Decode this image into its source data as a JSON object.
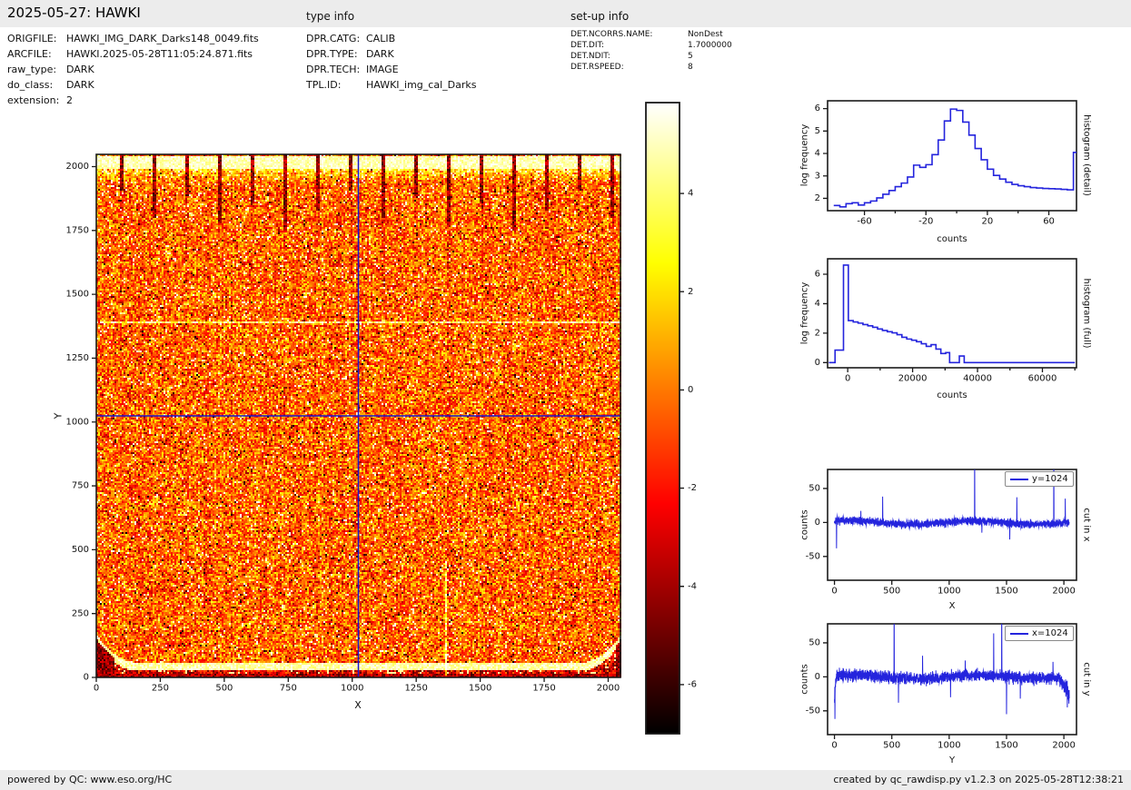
{
  "header": {
    "title": "2025-05-27: HAWKI",
    "type_info_heading": "type info",
    "setup_info_heading": "set-up info"
  },
  "file_info": {
    "rows": [
      {
        "label": "ORIGFILE:",
        "value": "HAWKI_IMG_DARK_Darks148_0049.fits"
      },
      {
        "label": "ARCFILE:",
        "value": "HAWKI.2025-05-28T11:05:24.871.fits"
      },
      {
        "label": "raw_type:",
        "value": "DARK"
      },
      {
        "label": "do_class:",
        "value": "DARK"
      },
      {
        "label": "extension:",
        "value": "2"
      }
    ]
  },
  "type_info": {
    "rows": [
      {
        "label": "DPR.CATG:",
        "value": "CALIB"
      },
      {
        "label": "DPR.TYPE:",
        "value": "DARK"
      },
      {
        "label": "DPR.TECH:",
        "value": "IMAGE"
      },
      {
        "label": "TPL.ID:",
        "value": "HAWKI_img_cal_Darks"
      }
    ]
  },
  "setup_info": {
    "rows": [
      {
        "label": "DET.NCORRS.NAME:",
        "value": "NonDest"
      },
      {
        "label": "DET.DIT:",
        "value": "1.7000000"
      },
      {
        "label": "DET.NDIT:",
        "value": "5"
      },
      {
        "label": "DET.RSPEED:",
        "value": "8"
      }
    ]
  },
  "footer": {
    "left": "powered by QC: www.eso.org/HC",
    "right": "created by qc_rawdisp.py v1.2.3 on 2025-05-28T12:38:21"
  },
  "colors": {
    "line_blue": "#2424dd",
    "crosshair_blue": "#1818cc",
    "frame": "#1a1a1a",
    "bar_bg": "#ececec",
    "text": "#111111"
  },
  "chart_data": [
    {
      "id": "main-image",
      "type": "heatmap",
      "xlabel": "X",
      "ylabel": "Y",
      "xlim": [
        0,
        2048
      ],
      "ylim": [
        0,
        2048
      ],
      "xticks": [
        0,
        250,
        500,
        750,
        1000,
        1250,
        1500,
        1750,
        2000
      ],
      "yticks": [
        0,
        250,
        500,
        750,
        1000,
        1250,
        1500,
        1750,
        2000
      ],
      "colormap": "hot",
      "noise": {
        "mean": 0.52,
        "spread": 0.17,
        "dark_fraction": 0.1,
        "bright_fraction": 0.07,
        "seed": 42
      },
      "features": {
        "top_band": {
          "y_from": 1992,
          "y_to": 2038
        },
        "top_streaks": {
          "start_x": 96,
          "spacing": 128,
          "count": 16,
          "min_len": 140,
          "max_len": 300
        },
        "bottom_band": {
          "center_y": 42,
          "half_width": 16,
          "edge_rise": 110,
          "left_edge_x": 160,
          "right_edge_x": 1890
        },
        "white_hline_y": 1388,
        "white_vline": {
          "x": 1363,
          "y_max": 450
        },
        "crosshair": {
          "x": 1024,
          "y": 1024
        }
      }
    },
    {
      "id": "colorbar",
      "type": "colorbar",
      "colormap": "hot",
      "vmax": 5.85,
      "vmin": -7.0,
      "ticks": [
        4,
        2,
        0,
        -2,
        -4,
        -6
      ]
    },
    {
      "id": "hist-detail",
      "type": "step-histogram",
      "xlabel": "counts",
      "ylabel": "log frequency",
      "right_label": "histogram (detail)",
      "xlim": [
        -84,
        78
      ],
      "ylim": [
        1.45,
        6.35
      ],
      "xticks": [
        -60,
        -20,
        20,
        60
      ],
      "xticks_minor": [
        -40,
        0,
        40
      ],
      "yticks": [
        2,
        3,
        4,
        5,
        6
      ],
      "bin_edges": [
        -80,
        -76,
        -72,
        -68,
        -64,
        -60,
        -56,
        -52,
        -48,
        -44,
        -40,
        -36,
        -32,
        -28,
        -24,
        -20,
        -16,
        -12,
        -8,
        -4,
        0,
        4,
        8,
        12,
        16,
        20,
        24,
        28,
        32,
        36,
        40,
        44,
        48,
        52,
        56,
        60,
        64,
        68,
        72,
        76,
        78
      ],
      "values": [
        1.68,
        1.62,
        1.76,
        1.8,
        1.7,
        1.8,
        1.88,
        2.02,
        2.18,
        2.35,
        2.52,
        2.68,
        2.95,
        3.48,
        3.38,
        3.5,
        3.95,
        4.6,
        5.45,
        5.98,
        5.92,
        5.4,
        4.82,
        4.22,
        3.72,
        3.3,
        3.02,
        2.86,
        2.72,
        2.62,
        2.56,
        2.52,
        2.48,
        2.46,
        2.44,
        2.43,
        2.42,
        2.4,
        2.38,
        4.05
      ]
    },
    {
      "id": "hist-full",
      "type": "step-histogram",
      "xlabel": "counts",
      "ylabel": "log frequency",
      "right_label": "histogram (full)",
      "xlim": [
        -6200,
        70500
      ],
      "ylim": [
        -0.35,
        7.05
      ],
      "xticks": [
        0,
        20000,
        40000,
        60000
      ],
      "xticks_minor": [
        10000,
        30000,
        50000,
        70000
      ],
      "yticks": [
        0,
        2,
        4,
        6
      ],
      "bin_edges": [
        -5800,
        -3900,
        -1300,
        200,
        1700,
        3200,
        4700,
        6200,
        7700,
        9200,
        10700,
        12200,
        13700,
        15200,
        16700,
        18200,
        19700,
        21200,
        22700,
        24200,
        25700,
        27200,
        28700,
        30200,
        31400,
        34400,
        35900,
        70000
      ],
      "values": [
        0,
        0.85,
        6.62,
        2.85,
        2.76,
        2.68,
        2.58,
        2.5,
        2.4,
        2.28,
        2.18,
        2.1,
        2.02,
        1.9,
        1.72,
        1.6,
        1.52,
        1.42,
        1.28,
        1.1,
        1.22,
        0.92,
        0.62,
        0.68,
        0.0,
        0.45,
        0.0
      ]
    },
    {
      "id": "cut-x",
      "type": "line-noise",
      "xlabel": "X",
      "ylabel": "counts",
      "right_label": "cut in x",
      "legend": "y=1024",
      "xlim": [
        -60,
        2110
      ],
      "ylim": [
        -85,
        78
      ],
      "xticks": [
        0,
        500,
        1000,
        1500,
        2000
      ],
      "yticks": [
        -50,
        0,
        50
      ],
      "n": 2048,
      "sigma": 4.8,
      "seed": 7,
      "spikes": [
        {
          "x": 18,
          "y": -38
        },
        {
          "x": 230,
          "y": 17
        },
        {
          "x": 420,
          "y": 38
        },
        {
          "x": 1222,
          "y": 120
        },
        {
          "x": 1285,
          "y": -15
        },
        {
          "x": 1528,
          "y": -25
        },
        {
          "x": 1590,
          "y": 37
        },
        {
          "x": 1912,
          "y": 130
        },
        {
          "x": 2012,
          "y": 35
        }
      ],
      "drift_start": {
        "n": 0,
        "v": 0
      },
      "drift_end": {
        "n": 0,
        "v": 0
      }
    },
    {
      "id": "cut-y",
      "type": "line-noise",
      "xlabel": "Y",
      "ylabel": "counts",
      "right_label": "cut in y",
      "legend": "x=1024",
      "xlim": [
        -60,
        2110
      ],
      "ylim": [
        -85,
        78
      ],
      "xticks": [
        0,
        500,
        1000,
        1500,
        2000
      ],
      "yticks": [
        -50,
        0,
        50
      ],
      "n": 2048,
      "sigma": 7.2,
      "seed": 13,
      "spikes": [
        {
          "x": 4,
          "y": -62
        },
        {
          "x": 520,
          "y": 130
        },
        {
          "x": 558,
          "y": -38
        },
        {
          "x": 768,
          "y": 31
        },
        {
          "x": 1012,
          "y": -30
        },
        {
          "x": 1140,
          "y": 24
        },
        {
          "x": 1388,
          "y": 64
        },
        {
          "x": 1458,
          "y": 130
        },
        {
          "x": 1500,
          "y": -55
        },
        {
          "x": 1620,
          "y": -32
        },
        {
          "x": 1905,
          "y": 22
        },
        {
          "x": 2030,
          "y": -45
        }
      ],
      "drift_start": {
        "n": 12,
        "v": -30
      },
      "drift_end": {
        "n": 90,
        "v": -28
      }
    }
  ]
}
